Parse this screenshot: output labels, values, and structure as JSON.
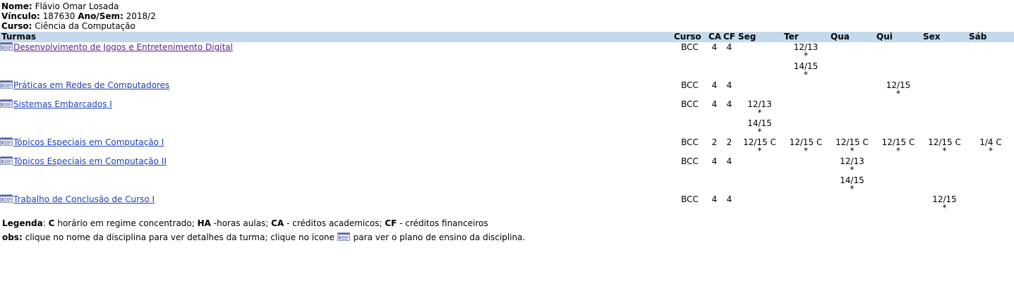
{
  "info": {
    "nome_label": "Nome:",
    "nome": "Flávio Omar Losada",
    "vinculo_label": "Vínculo:",
    "vinculo": "187630",
    "anosem_label": "Ano/Sem:",
    "anosem": "2018/2",
    "curso_label": "Curso:",
    "curso": "Ciência da Computação"
  },
  "headers": {
    "turmas": "Turmas",
    "curso": "Curso",
    "ca": "CA",
    "cf": "CF",
    "seg": "Seg",
    "ter": "Ter",
    "qua": "Qua",
    "qui": "Qui",
    "sex": "Sex",
    "sab": "Sáb"
  },
  "rows": [
    {
      "name": "Desenvolvimento de Jogos e Entretenimento Digital",
      "curso": "BCC",
      "ca": "4",
      "cf": "4",
      "seg": [],
      "ter": [
        "12/13",
        "14/15"
      ],
      "qua": [],
      "qui": [],
      "sex": [],
      "sab": []
    },
    {
      "name": "Práticas em Redes de Computadores",
      "curso": "BCC",
      "ca": "4",
      "cf": "4",
      "seg": [],
      "ter": [],
      "qua": [],
      "qui": [
        "12/15"
      ],
      "sex": [],
      "sab": []
    },
    {
      "name": "Sistemas Embarcados I",
      "curso": "BCC",
      "ca": "4",
      "cf": "4",
      "seg": [
        "12/13",
        "14/15"
      ],
      "ter": [],
      "qua": [],
      "qui": [],
      "sex": [],
      "sab": []
    },
    {
      "name": "Tópicos Especiais em Computação I",
      "curso": "BCC",
      "ca": "2",
      "cf": "2",
      "seg": [
        "12/15 C"
      ],
      "ter": [
        "12/15 C"
      ],
      "qua": [
        "12/15 C"
      ],
      "qui": [
        "12/15 C"
      ],
      "sex": [
        "12/15 C"
      ],
      "sab": [
        "1/4 C"
      ]
    },
    {
      "name": "Tópicos Especiais em Computação II",
      "curso": "BCC",
      "ca": "4",
      "cf": "4",
      "seg": [],
      "ter": [],
      "qua": [
        "12/13",
        "14/15"
      ],
      "qui": [],
      "sex": [],
      "sab": []
    },
    {
      "name": "Trabalho de Conclusão de Curso I",
      "curso": "BCC",
      "ca": "4",
      "cf": "4",
      "seg": [],
      "ter": [],
      "qua": [],
      "qui": [],
      "sex": [
        "12/15"
      ],
      "sab": []
    }
  ],
  "slot_mark": "*",
  "legend": {
    "label": "Legenda",
    "c": "C",
    "c_text": " horário em regime concentrado; ",
    "ha": "HA",
    "ha_text": " -horas aulas; ",
    "ca": "CA",
    "ca_text": " - créditos academicos; ",
    "cf": "CF",
    "cf_text": " - créditos financeiros",
    "obs_label": "obs:",
    "obs_text1": " clique no nome da disciplina para ver detalhes da turma; clique no ícone ",
    "obs_text2": " para ver o plano de ensino da disciplina."
  },
  "colors": {
    "header_bg": "#c5d9ec",
    "link": "#1a3fbf"
  },
  "icons": {
    "plan": "plan-document-icon"
  }
}
